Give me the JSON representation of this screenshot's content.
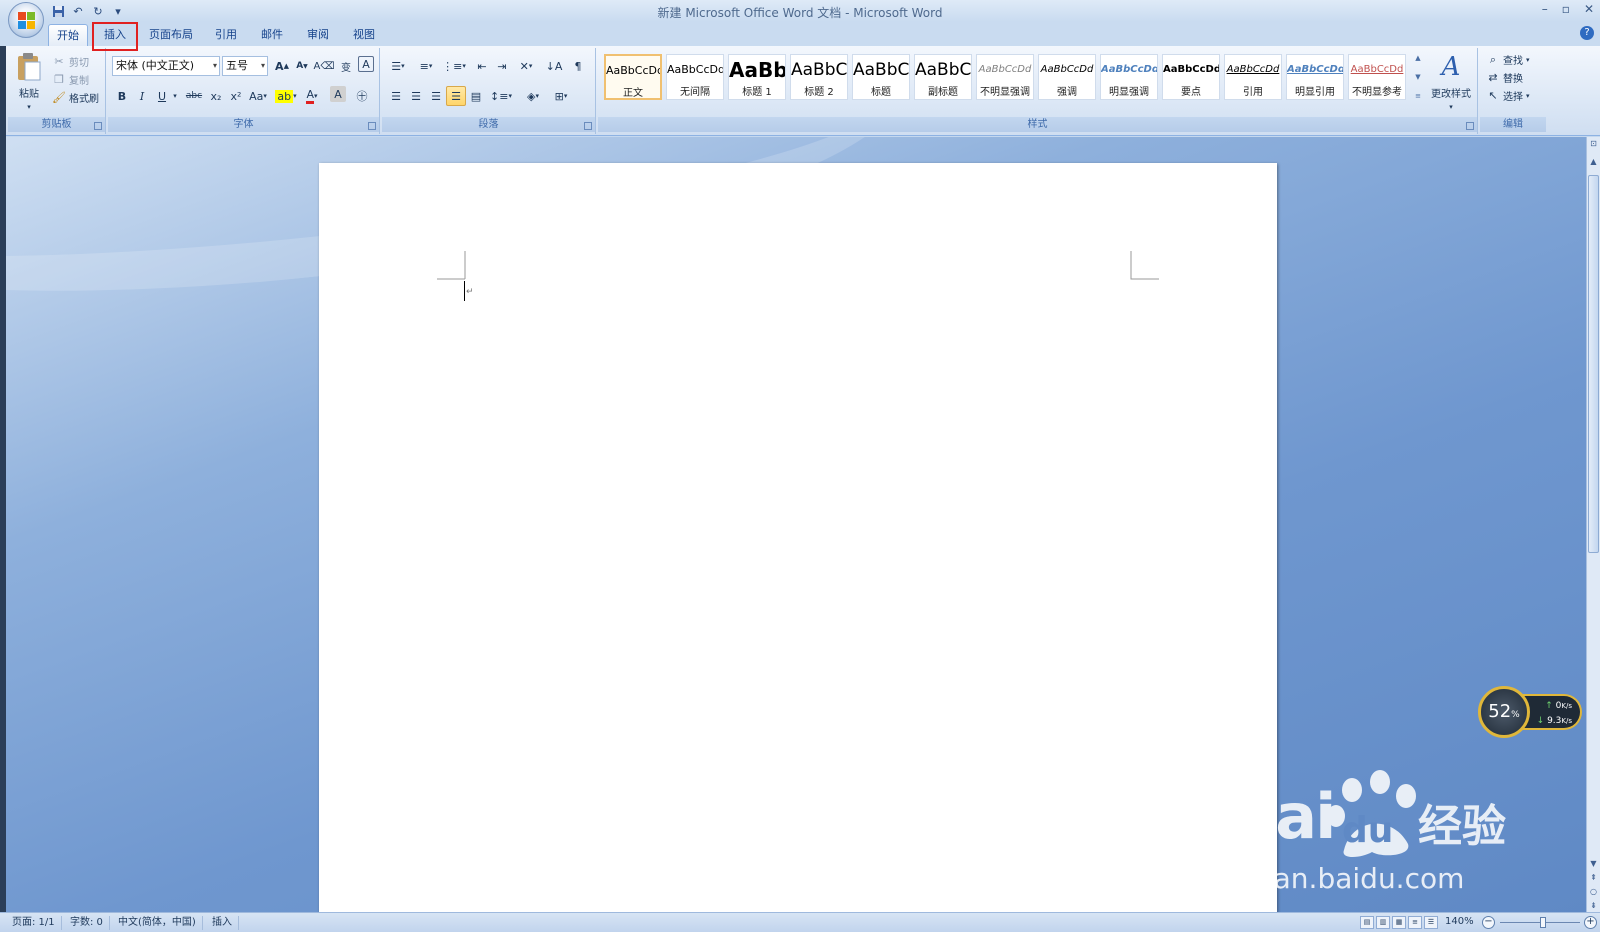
{
  "window": {
    "title": "新建 Microsoft Office Word 文档 - Microsoft Word",
    "controls": [
      "–",
      "▫",
      "✕"
    ]
  },
  "tabs": [
    {
      "label": "开始",
      "active": true
    },
    {
      "label": "插入",
      "active": false,
      "highlighted": true
    },
    {
      "label": "页面布局",
      "active": false
    },
    {
      "label": "引用",
      "active": false
    },
    {
      "label": "邮件",
      "active": false
    },
    {
      "label": "审阅",
      "active": false
    },
    {
      "label": "视图",
      "active": false
    }
  ],
  "clipboard": {
    "label": "剪贴板",
    "paste": "粘贴",
    "cut": "剪切",
    "copy": "复制",
    "format_painter": "格式刷"
  },
  "font": {
    "label": "字体",
    "family": "宋体 (中文正文)",
    "size": "五号",
    "grow": "A",
    "shrink": "A",
    "bold": "B",
    "italic": "I",
    "underline": "U",
    "strike": "abc",
    "subscript": "x₂",
    "superscript": "x²",
    "change_case": "Aa",
    "font_color_letter": "A",
    "char_shading": "A",
    "phonetic": "变"
  },
  "paragraph": {
    "label": "段落"
  },
  "styles": {
    "label": "样式",
    "items": [
      {
        "sample": "AaBbCcDd",
        "name": "正文",
        "selected": true
      },
      {
        "sample": "AaBbCcDd",
        "name": "无间隔",
        "selected": false
      },
      {
        "sample": "AaBb",
        "name": "标题 1",
        "selected": false
      },
      {
        "sample": "AaBbC",
        "name": "标题 2",
        "selected": false
      },
      {
        "sample": "AaBbC",
        "name": "标题",
        "selected": false
      },
      {
        "sample": "AaBbC",
        "name": "副标题",
        "selected": false
      },
      {
        "sample": "AaBbCcDd",
        "name": "不明显强调",
        "selected": false
      },
      {
        "sample": "AaBbCcDd",
        "name": "强调",
        "selected": false
      },
      {
        "sample": "AaBbCcDd",
        "name": "明显强调",
        "selected": false
      },
      {
        "sample": "AaBbCcDd",
        "name": "要点",
        "selected": false
      },
      {
        "sample": "AaBbCcDd",
        "name": "引用",
        "selected": false
      },
      {
        "sample": "AaBbCcDd",
        "name": "明显引用",
        "selected": false
      },
      {
        "sample": "AaBbCcDd",
        "name": "不明显参考",
        "selected": false
      }
    ],
    "change_styles": "更改样式"
  },
  "editing": {
    "label": "编辑",
    "find": "查找",
    "replace": "替换",
    "select": "选择"
  },
  "net_widget": {
    "percent": "52",
    "percent_unit": "%",
    "upload": "0",
    "upload_unit": "K/s",
    "download": "9.3",
    "download_unit": "K/s"
  },
  "watermark": {
    "brand": "Bai",
    "brand_du": "du",
    "jingyan": "经验",
    "url": "jingyan.baidu.com"
  },
  "status": {
    "page": "页面: 1/1",
    "words": "字数: 0",
    "language": "中文(简体，中国)",
    "mode": "插入",
    "zoom": "140%"
  },
  "colors": {
    "accent": "#15428b",
    "highlight_border": "#e02020",
    "ribbon_bg": "#dde8f6"
  }
}
